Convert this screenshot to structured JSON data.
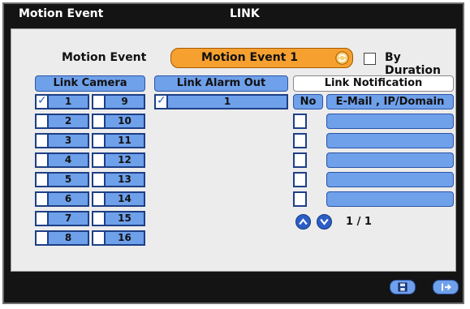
{
  "title": {
    "left": "Motion Event",
    "center": "LINK"
  },
  "motion": {
    "label": "Motion Event",
    "value": "Motion Event 1",
    "by_duration_label": "By Duration",
    "by_duration_checked": false
  },
  "link_camera": {
    "header": "Link Camera",
    "left": [
      {
        "n": "1",
        "checked": true
      },
      {
        "n": "2",
        "checked": false
      },
      {
        "n": "3",
        "checked": false
      },
      {
        "n": "4",
        "checked": false
      },
      {
        "n": "5",
        "checked": false
      },
      {
        "n": "6",
        "checked": false
      },
      {
        "n": "7",
        "checked": false
      },
      {
        "n": "8",
        "checked": false
      }
    ],
    "right": [
      {
        "n": "9",
        "checked": false
      },
      {
        "n": "10",
        "checked": false
      },
      {
        "n": "11",
        "checked": false
      },
      {
        "n": "12",
        "checked": false
      },
      {
        "n": "13",
        "checked": false
      },
      {
        "n": "14",
        "checked": false
      },
      {
        "n": "15",
        "checked": false
      },
      {
        "n": "16",
        "checked": false
      }
    ]
  },
  "link_alarm": {
    "header": "Link Alarm Out",
    "items": [
      {
        "n": "1",
        "checked": true
      }
    ]
  },
  "link_notification": {
    "header": "Link Notification",
    "col_no": "No",
    "col_email": "E-Mail , IP/Domain",
    "rows": 6,
    "pager": "1 / 1"
  },
  "footer": {
    "save_icon": "save-icon",
    "exit_icon": "exit-icon"
  }
}
